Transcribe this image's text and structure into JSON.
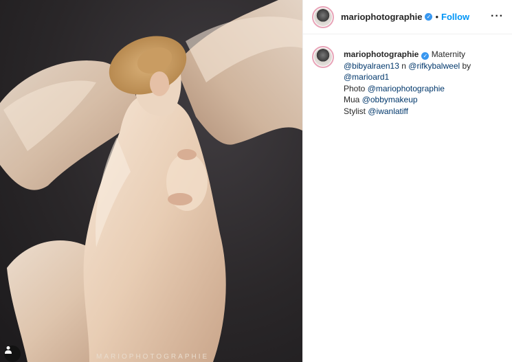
{
  "photo": {
    "watermark": "MARIOPHOTOGRAPHIE",
    "user_tag_icon": "person-icon"
  },
  "header": {
    "username": "mariophotographie",
    "verified_icon": "verified-badge-icon",
    "separator": "•",
    "follow_label": "Follow",
    "more_label": "···"
  },
  "caption": {
    "username": "mariophotographie",
    "text_start": "Maternity",
    "mention1": "@bibyalraen13",
    "connector": "n",
    "mention2": "@rifkybalweel",
    "by": "by",
    "mention3": "@marioard1",
    "photo_label": "Photo",
    "mention4": "@mariophotographie",
    "mua_label": "Mua",
    "mention5": "@obbymakeup",
    "stylist_label": "Stylist",
    "mention6": "@iwanlatiff"
  },
  "colors": {
    "link": "#00376b",
    "follow": "#0095f6",
    "verified": "#3897f0"
  }
}
